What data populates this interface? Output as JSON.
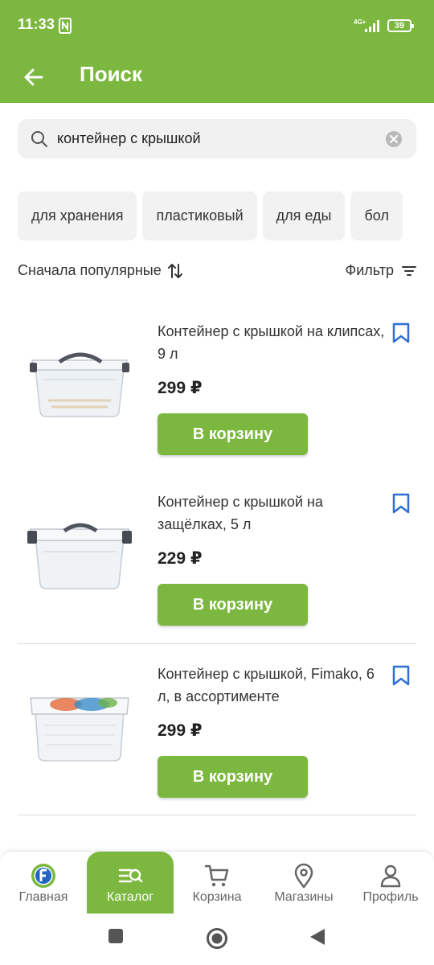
{
  "status_bar": {
    "time": "11:33",
    "network": "4G+",
    "battery": "39"
  },
  "app_bar": {
    "title": "Поиск"
  },
  "search": {
    "value": "контейнер с крышкой"
  },
  "chips": [
    "для хранения",
    "пластиковый",
    "для еды",
    "бол"
  ],
  "sort": {
    "label": "Сначала популярные"
  },
  "filter": {
    "label": "Фильтр"
  },
  "products": [
    {
      "name": "Контейнер с крышкой на клипсах, 9 л",
      "price": "299 ₽",
      "button": "В корзину"
    },
    {
      "name": "Контейнер с крышкой на защёлках, 5 л",
      "price": "229 ₽",
      "button": "В корзину"
    },
    {
      "name": "Контейнер с крышкой, Fimako, 6 л, в ассортименте",
      "price": "299 ₽",
      "button": "В корзину"
    }
  ],
  "bottom_nav": [
    {
      "label": "Главная",
      "icon": "home-logo-icon"
    },
    {
      "label": "Каталог",
      "icon": "catalog-icon",
      "active": true
    },
    {
      "label": "Корзина",
      "icon": "cart-icon"
    },
    {
      "label": "Магазины",
      "icon": "map-pin-icon"
    },
    {
      "label": "Профиль",
      "icon": "profile-icon"
    }
  ],
  "colors": {
    "accent": "#7cb83f",
    "bookmark": "#2e6fd1"
  }
}
